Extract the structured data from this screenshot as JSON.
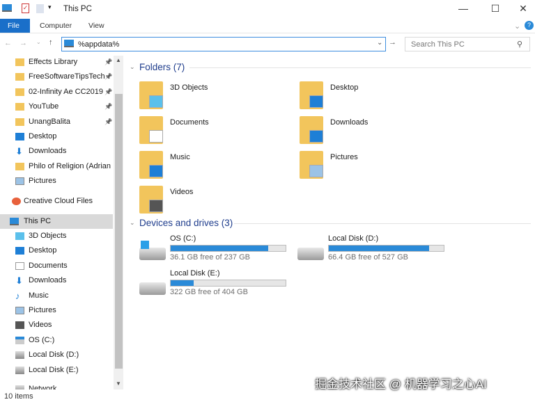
{
  "window": {
    "title": "This PC",
    "minimize": "—",
    "maximize": "☐",
    "close": "✕"
  },
  "ribbon": {
    "tabs": [
      "File",
      "Computer",
      "View"
    ],
    "help": "?"
  },
  "address": {
    "value": "%appdata%",
    "search_placeholder": "Search This PC"
  },
  "nav": {
    "quick": [
      {
        "label": "Effects Library",
        "icon": "folder",
        "pin": true
      },
      {
        "label": "FreeSoftwareTipsTech",
        "icon": "folder",
        "pin": true
      },
      {
        "label": "02-Infinity Ae CC2019",
        "icon": "folder",
        "pin": true
      },
      {
        "label": "YouTube",
        "icon": "folder",
        "pin": true
      },
      {
        "label": "UnangBalita",
        "icon": "folder",
        "pin": true
      },
      {
        "label": "Desktop",
        "icon": "desktop"
      },
      {
        "label": "Downloads",
        "icon": "download"
      },
      {
        "label": "Philo of Religion (Adrian F",
        "icon": "folder"
      },
      {
        "label": "Pictures",
        "icon": "pictures"
      }
    ],
    "creative_cloud": "Creative Cloud Files",
    "this_pc": "This PC",
    "pc_items": [
      {
        "label": "3D Objects",
        "icon": "cube"
      },
      {
        "label": "Desktop",
        "icon": "desktop"
      },
      {
        "label": "Documents",
        "icon": "document"
      },
      {
        "label": "Downloads",
        "icon": "download"
      },
      {
        "label": "Music",
        "icon": "music"
      },
      {
        "label": "Pictures",
        "icon": "pictures"
      },
      {
        "label": "Videos",
        "icon": "video"
      },
      {
        "label": "OS (C:)",
        "icon": "windows-drive"
      },
      {
        "label": "Local Disk (D:)",
        "icon": "drive"
      },
      {
        "label": "Local Disk (E:)",
        "icon": "drive"
      }
    ],
    "network": "Network"
  },
  "content": {
    "folders_header": "Folders (7)",
    "folders": [
      "3D Objects",
      "Desktop",
      "Documents",
      "Downloads",
      "Music",
      "Pictures",
      "Videos"
    ],
    "devices_header": "Devices and drives (3)",
    "drives": [
      {
        "name": "OS (C:)",
        "free": "36.1 GB free of 237 GB",
        "used_pct": 85
      },
      {
        "name": "Local Disk (D:)",
        "free": "66.4 GB free of 527 GB",
        "used_pct": 87
      },
      {
        "name": "Local Disk (E:)",
        "free": "322 GB free of 404 GB",
        "used_pct": 20
      }
    ]
  },
  "status": "10 items",
  "watermark": "掘金技术社区 @ 机器学习之心AI",
  "colors": {
    "accent": "#1a6fc9",
    "bar": "#2a8ad8",
    "header": "#1e3c8c"
  }
}
